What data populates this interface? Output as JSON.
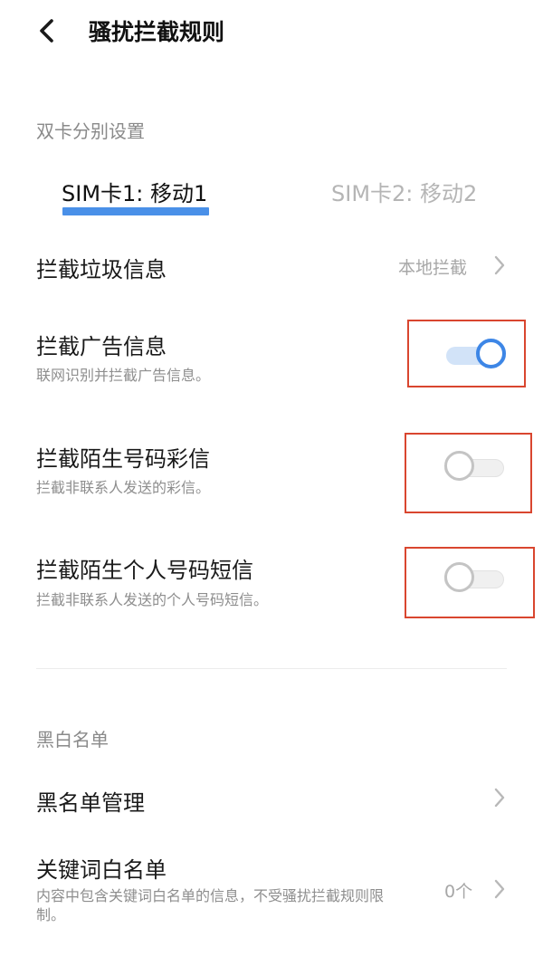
{
  "header": {
    "title": "骚扰拦截规则"
  },
  "dual_sim": {
    "section_label": "双卡分别设置",
    "tabs": [
      {
        "label": "SIM卡1: 移动1",
        "selected": true
      },
      {
        "label": "SIM卡2: 移动2",
        "selected": false
      }
    ]
  },
  "settings": {
    "spam": {
      "title": "拦截垃圾信息",
      "value": "本地拦截"
    },
    "ads": {
      "title": "拦截广告信息",
      "subtitle": "联网识别并拦截广告信息。",
      "enabled": true
    },
    "stranger_mms": {
      "title": "拦截陌生号码彩信",
      "subtitle": "拦截非联系人发送的彩信。",
      "enabled": false
    },
    "stranger_personal_sms": {
      "title": "拦截陌生个人号码短信",
      "subtitle": "拦截非联系人发送的个人号码短信。",
      "enabled": false
    }
  },
  "lists": {
    "section_label": "黑白名单",
    "blacklist": {
      "title": "黑名单管理"
    },
    "keyword_whitelist": {
      "title": "关键词白名单",
      "subtitle": "内容中包含关键词白名单的信息，不受骚扰拦截规则限制。",
      "value": "0个"
    }
  },
  "colors": {
    "accent": "#3d86e6",
    "tab_indicator": "#4a90e8",
    "annotation": "#d9462f"
  },
  "icons": {
    "back": "chevron-left-icon",
    "row_arrow": "chevron-right-icon"
  }
}
